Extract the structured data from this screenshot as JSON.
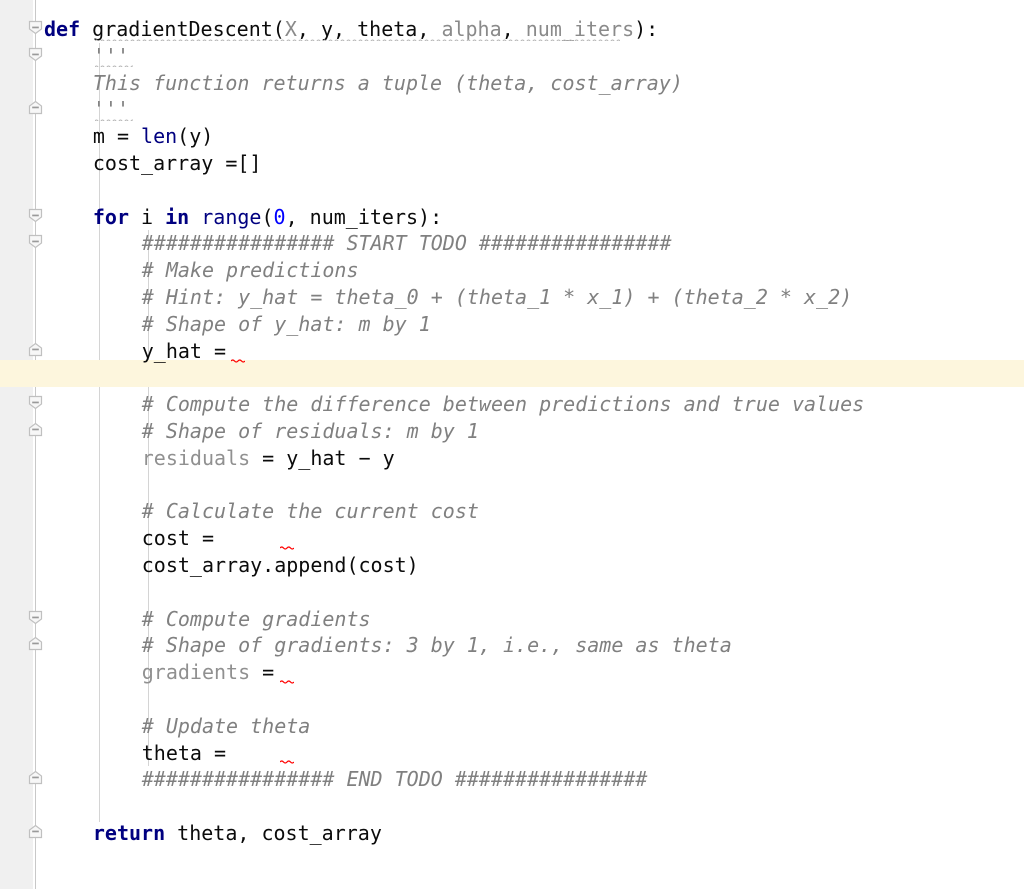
{
  "editor": {
    "language": "python",
    "font_size_px": 20,
    "colors": {
      "background": "#ffffff",
      "gutter_background": "#f0f0f0",
      "current_line_highlight": "#fdf6dd",
      "keyword": "#000080",
      "comment": "#808080",
      "number": "#0000ff",
      "parameter": "#8a8a8a",
      "text": "#0b0b0b",
      "indent_guide": "#d4d4d4",
      "fold_marker": "#c8c8c8",
      "error_squiggle": "#ff0000"
    },
    "current_line_number": 11
  },
  "code_lines": [
    {
      "n": 1,
      "indent": 0,
      "tokens": [
        {
          "t": "def",
          "c": "kw"
        },
        {
          "t": " ",
          "c": "plain"
        },
        {
          "t": "gradientDescent",
          "c": "plain"
        },
        {
          "t": "(",
          "c": "plain"
        },
        {
          "t": "X",
          "c": "param"
        },
        {
          "t": ", ",
          "c": "plain"
        },
        {
          "t": "y",
          "c": "plain"
        },
        {
          "t": ", ",
          "c": "plain"
        },
        {
          "t": "theta",
          "c": "plain"
        },
        {
          "t": ", ",
          "c": "plain"
        },
        {
          "t": "alpha",
          "c": "param"
        },
        {
          "t": ", ",
          "c": "plain"
        },
        {
          "t": "num_iters",
          "c": "param"
        },
        {
          "t": "):",
          "c": "plain"
        }
      ]
    },
    {
      "n": 2,
      "indent": 4,
      "tokens": [
        {
          "t": "'''",
          "c": "doc"
        }
      ]
    },
    {
      "n": 3,
      "indent": 4,
      "tokens": [
        {
          "t": "This function returns a tuple (theta, cost_array)",
          "c": "doc"
        }
      ]
    },
    {
      "n": 4,
      "indent": 4,
      "tokens": [
        {
          "t": "'''",
          "c": "doc"
        }
      ]
    },
    {
      "n": 5,
      "indent": 4,
      "tokens": [
        {
          "t": "m = ",
          "c": "plain"
        },
        {
          "t": "len",
          "c": "builtin"
        },
        {
          "t": "(y)",
          "c": "plain"
        }
      ]
    },
    {
      "n": 6,
      "indent": 4,
      "tokens": [
        {
          "t": "cost_array =[]",
          "c": "plain"
        }
      ]
    },
    {
      "n": 7,
      "indent": 0,
      "tokens": []
    },
    {
      "n": 8,
      "indent": 4,
      "tokens": [
        {
          "t": "for",
          "c": "kw"
        },
        {
          "t": " i ",
          "c": "plain"
        },
        {
          "t": "in",
          "c": "kw"
        },
        {
          "t": " ",
          "c": "plain"
        },
        {
          "t": "range",
          "c": "builtin"
        },
        {
          "t": "(",
          "c": "plain"
        },
        {
          "t": "0",
          "c": "num"
        },
        {
          "t": ", num_iters):",
          "c": "plain"
        }
      ]
    },
    {
      "n": 9,
      "indent": 8,
      "tokens": [
        {
          "t": "################ START TODO ################",
          "c": "cmt"
        }
      ]
    },
    {
      "n": 10,
      "indent": 8,
      "tokens": [
        {
          "t": "# Make predictions",
          "c": "cmt"
        }
      ]
    },
    {
      "n": 11,
      "indent": 8,
      "tokens": [
        {
          "t": "# Hint: y_hat = theta_0 + (theta_1 * x_1) + (theta_2 * x_2)",
          "c": "cmt"
        }
      ]
    },
    {
      "n": 12,
      "indent": 8,
      "tokens": [
        {
          "t": "# Shape of y_hat: m by 1",
          "c": "cmt"
        }
      ]
    },
    {
      "n": 13,
      "indent": 8,
      "tokens": [
        {
          "t": "y_hat =",
          "c": "plain"
        }
      ]
    },
    {
      "n": 14,
      "indent": 0,
      "tokens": []
    },
    {
      "n": 15,
      "indent": 8,
      "tokens": [
        {
          "t": "# Compute the difference between predictions and true values",
          "c": "cmt"
        }
      ]
    },
    {
      "n": 16,
      "indent": 8,
      "tokens": [
        {
          "t": "# Shape of residuals: m by 1",
          "c": "cmt"
        }
      ]
    },
    {
      "n": 17,
      "indent": 8,
      "tokens": [
        {
          "t": "residuals",
          "c": "unused"
        },
        {
          "t": " = y_hat ",
          "c": "plain"
        },
        {
          "t": "−",
          "c": "plain"
        },
        {
          "t": " y",
          "c": "plain"
        }
      ]
    },
    {
      "n": 18,
      "indent": 0,
      "tokens": []
    },
    {
      "n": 19,
      "indent": 8,
      "tokens": [
        {
          "t": "# Calculate the current cost",
          "c": "cmt"
        }
      ]
    },
    {
      "n": 20,
      "indent": 8,
      "tokens": [
        {
          "t": "cost =",
          "c": "plain"
        }
      ]
    },
    {
      "n": 21,
      "indent": 8,
      "tokens": [
        {
          "t": "cost_array.append(cost)",
          "c": "plain"
        }
      ]
    },
    {
      "n": 22,
      "indent": 0,
      "tokens": []
    },
    {
      "n": 23,
      "indent": 8,
      "tokens": [
        {
          "t": "# Compute gradients",
          "c": "cmt"
        }
      ]
    },
    {
      "n": 24,
      "indent": 8,
      "tokens": [
        {
          "t": "# Shape of gradients: 3 by 1, i.e., same as theta",
          "c": "cmt"
        }
      ]
    },
    {
      "n": 25,
      "indent": 8,
      "tokens": [
        {
          "t": "gradients",
          "c": "unused"
        },
        {
          "t": " =",
          "c": "plain"
        }
      ]
    },
    {
      "n": 26,
      "indent": 0,
      "tokens": []
    },
    {
      "n": 27,
      "indent": 8,
      "tokens": [
        {
          "t": "# Update theta",
          "c": "cmt"
        }
      ]
    },
    {
      "n": 28,
      "indent": 8,
      "tokens": [
        {
          "t": "theta =",
          "c": "plain"
        }
      ]
    },
    {
      "n": 29,
      "indent": 8,
      "tokens": [
        {
          "t": "################ END TODO ################",
          "c": "cmt"
        }
      ]
    },
    {
      "n": 30,
      "indent": 0,
      "tokens": []
    },
    {
      "n": 31,
      "indent": 4,
      "tokens": [
        {
          "t": "return",
          "c": "kw"
        },
        {
          "t": " theta, cost_array",
          "c": "plain"
        }
      ]
    }
  ],
  "fold_markers": [
    {
      "name": "fold-collapse-def-gradientdescent",
      "line": 1,
      "shape": "collapse"
    },
    {
      "name": "fold-collapse-docstring",
      "line": 2,
      "shape": "collapse"
    },
    {
      "name": "fold-expand-docstring-end",
      "line": 4,
      "shape": "expand"
    },
    {
      "name": "fold-collapse-for-loop",
      "line": 8,
      "shape": "collapse"
    },
    {
      "name": "fold-collapse-todo-block",
      "line": 9,
      "shape": "collapse"
    },
    {
      "name": "fold-expand-yhat-region",
      "line": 13,
      "shape": "expand"
    },
    {
      "name": "fold-collapse-residuals-region",
      "line": 15,
      "shape": "collapse"
    },
    {
      "name": "fold-expand-residuals-region",
      "line": 16,
      "shape": "expand"
    },
    {
      "name": "fold-collapse-gradients-region",
      "line": 23,
      "shape": "collapse"
    },
    {
      "name": "fold-expand-gradients-region",
      "line": 24,
      "shape": "expand"
    },
    {
      "name": "fold-expand-end-todo",
      "line": 29,
      "shape": "expand"
    },
    {
      "name": "fold-expand-return",
      "line": 31,
      "shape": "expand"
    }
  ],
  "error_markers": [
    {
      "name": "error-squiggle-y-hat-assign",
      "line": 13
    },
    {
      "name": "error-squiggle-cost-assign",
      "line": 20
    },
    {
      "name": "error-squiggle-gradients-assign",
      "line": 25
    },
    {
      "name": "error-squiggle-theta-assign",
      "line": 28
    }
  ],
  "warning_markers": [
    {
      "name": "warning-squiggle-def-signature",
      "line": 1
    },
    {
      "name": "warning-squiggle-docstring-open",
      "line": 2
    },
    {
      "name": "warning-squiggle-docstring-close",
      "line": 4
    }
  ]
}
